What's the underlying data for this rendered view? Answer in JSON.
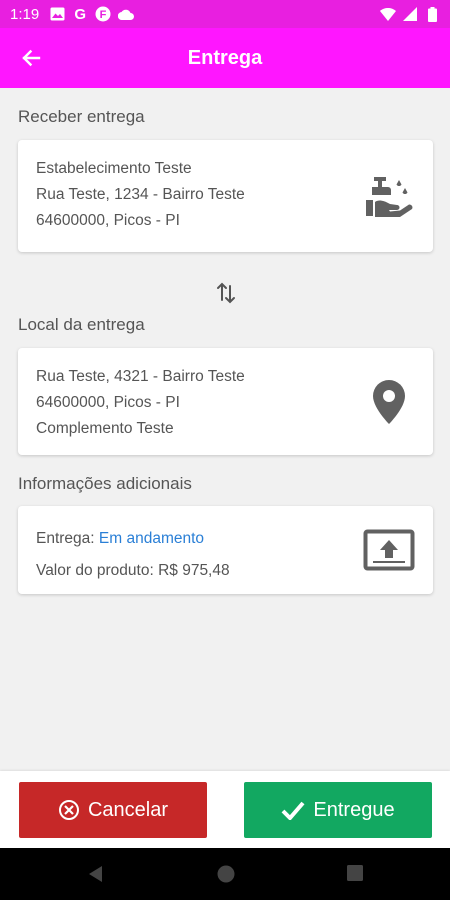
{
  "status_bar": {
    "time": "1:19",
    "left_icons": [
      "image-icon",
      "google-icon",
      "f-app-icon",
      "cloud-icon"
    ],
    "right_icons": [
      "wifi-icon",
      "signal-icon",
      "battery-icon"
    ]
  },
  "app_bar": {
    "title": "Entrega",
    "color": "#ff16ff"
  },
  "pickup": {
    "section_title": "Receber entrega",
    "lines": [
      "Estabelecimento Teste",
      "Rua Teste, 1234 - Bairro Teste",
      "64600000, Picos - PI"
    ],
    "icon": "hand-wash-icon"
  },
  "swap_icon": "swap-vertical-icon",
  "dropoff": {
    "section_title": "Local da entrega",
    "lines": [
      "Rua Teste, 4321 - Bairro Teste",
      "64600000, Picos - PI",
      "Complemento Teste"
    ],
    "icon": "map-marker-icon"
  },
  "info": {
    "section_title": "Informações adicionais",
    "delivery_label": "Entrega:",
    "delivery_status": "Em andamento",
    "value_label": "Valor do produto:",
    "value": "R$ 975,48",
    "icon": "upload-box-icon"
  },
  "actions": {
    "cancel_label": "Cancelar",
    "cancel_color": "#c62828",
    "deliver_label": "Entregue",
    "deliver_color": "#12a861"
  },
  "nav": [
    "back-triangle-icon",
    "home-circle-icon",
    "recents-square-icon"
  ]
}
